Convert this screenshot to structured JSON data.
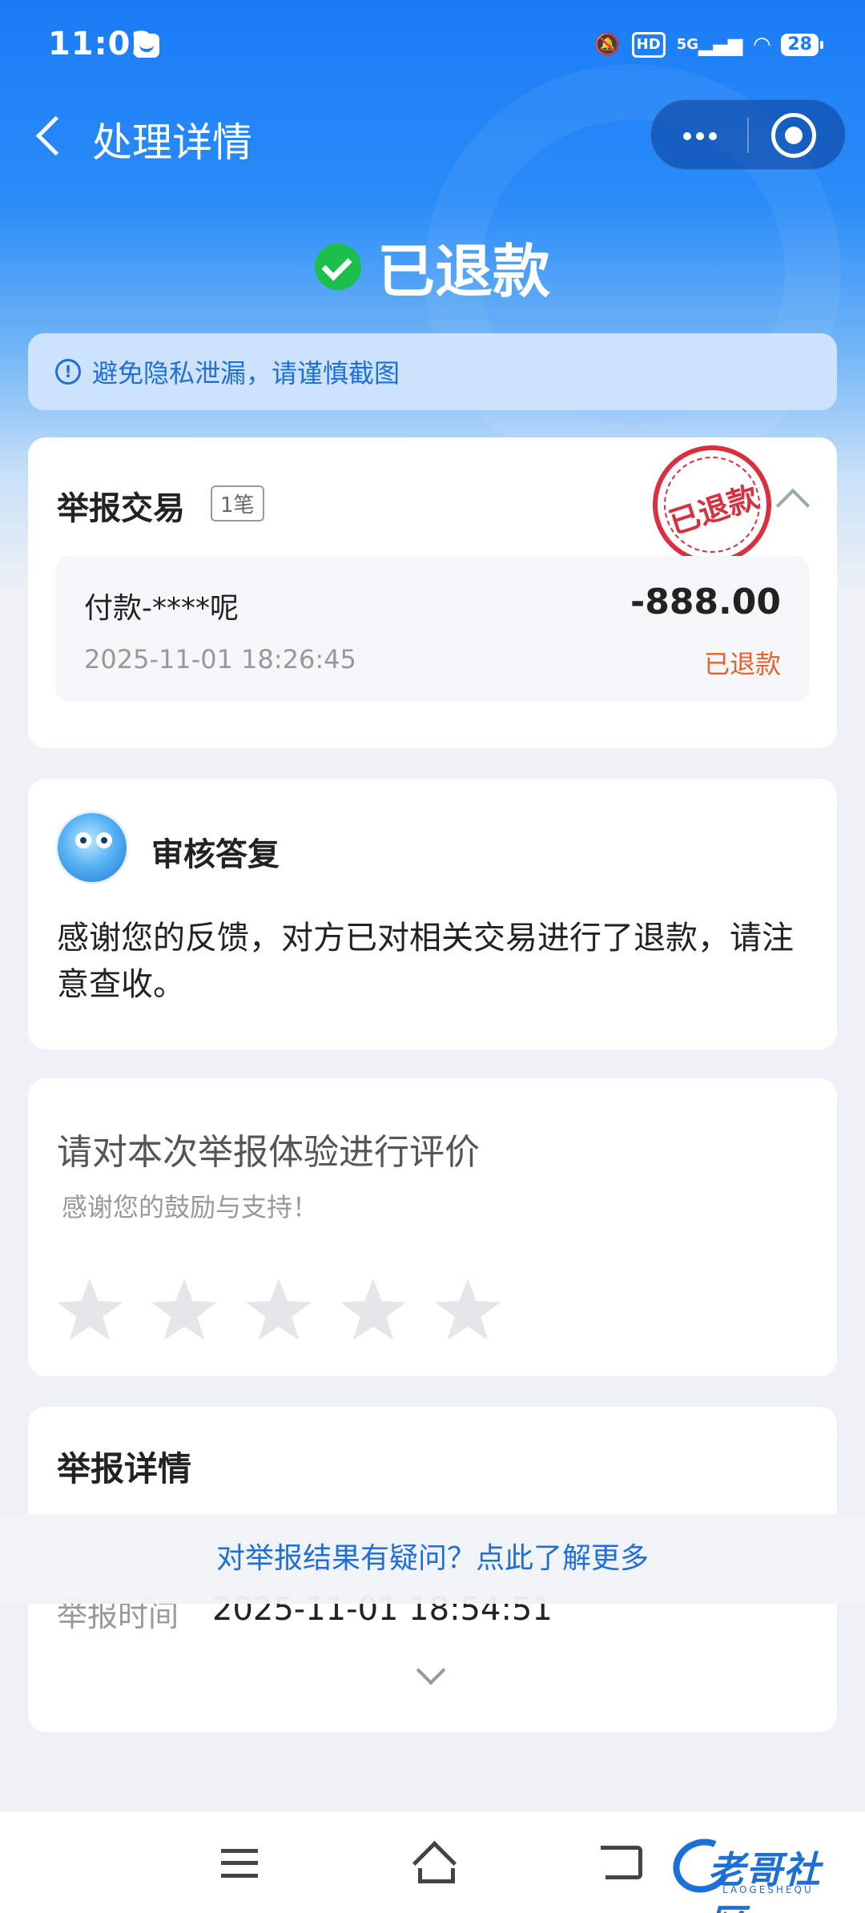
{
  "status_bar": {
    "time": "11:02",
    "network": "5G",
    "hd": "HD",
    "battery": "28",
    "icons": [
      "app-notification-icon",
      "mute-icon",
      "hd-icon",
      "signal-5g-icon",
      "wifi-icon",
      "battery-icon"
    ]
  },
  "nav": {
    "title": "处理详情",
    "back_icon": "chevron-left-icon",
    "more_icon": "more-dots-icon",
    "close_icon": "target-close-icon"
  },
  "status": {
    "text": "已退款",
    "color": "#1bbf4a"
  },
  "notice": {
    "text": "避免隐私泄漏，请谨慎截图"
  },
  "report_card": {
    "title": "举报交易",
    "count": "1笔",
    "stamp": "已退款",
    "transaction": {
      "name": "付款-****呢",
      "time": "2025-11-01 18:26:45",
      "amount": "-888.00",
      "state": "已退款",
      "state_color": "#e8612c"
    }
  },
  "review_card": {
    "title": "审核答复",
    "body": "感谢您的反馈，对方已对相关交易进行了退款，请注意查收。"
  },
  "rating_card": {
    "title": "请对本次举报体验进行评价",
    "subtitle": "感谢您的鼓励与支持！",
    "stars": 5,
    "rating": 0
  },
  "details_card": {
    "title": "举报详情",
    "rows": [
      {
        "label": "举报时间",
        "value": "2025-11-01 18:54:51"
      }
    ]
  },
  "faq_link": "对举报结果有疑问？点此了解更多",
  "watermark": {
    "text": "老哥社区",
    "sub": "LAOGESHEQU"
  },
  "colors": {
    "primary": "#1a7cf5",
    "link": "#1f6fd6",
    "stamp": "#d8303e"
  }
}
